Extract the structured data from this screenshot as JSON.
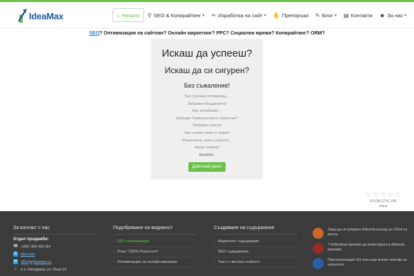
{
  "header": {
    "logo": {
      "text_a": "Idea",
      "text_b": "Max"
    },
    "nav": [
      {
        "label": "Начало",
        "icon": "home-icon",
        "active": true,
        "dropdown": false
      },
      {
        "label": "SEO & Копирайтинг",
        "icon": "search-icon",
        "active": false,
        "dropdown": true
      },
      {
        "label": "Изработка на сайт",
        "icon": "tools-icon",
        "active": false,
        "dropdown": true
      },
      {
        "label": "Препоръки",
        "icon": "thumbs-up-icon",
        "active": false,
        "dropdown": false
      },
      {
        "label": "Блог",
        "icon": "pen-icon",
        "active": false,
        "dropdown": true
      },
      {
        "label": "Контакти",
        "icon": "contacts-icon",
        "active": false,
        "dropdown": false
      },
      {
        "label": "За нас",
        "icon": "user-icon",
        "active": false,
        "dropdown": true
      }
    ]
  },
  "tagline": {
    "link": "SEO",
    "rest": "? Оптимизация на сайтове? Онлайн маркетинг? PPC? Социални мрежи? Копирайтинг? ORM?"
  },
  "hero": {
    "h1": "Искаш да успееш?",
    "h2": "Искаш да си сигурен?",
    "h3": "Без съжаление!",
    "lines": [
      "Без глупава оптимизац...",
      "Забрави обещанията!",
      "Без колебание...",
      "Забрави \"комплексните стратегии\"!",
      "Забрави стреса!",
      "Ние знаем какво е нужно!",
      "Решенията, които работят...",
      "Нищо повече!"
    ],
    "brand": "IdeaMax.",
    "cta": "Действай днес!"
  },
  "rating": {
    "stars_filled": 0,
    "stars_total": 5,
    "text_line1": "4.8 (96.27%) 158",
    "text_line2": "гласа"
  },
  "footer": {
    "contact": {
      "title": "За контакт с нас",
      "sales_label": "Отдел продажби:",
      "phone": "+359 / 896 454 354",
      "skype": "idea-max",
      "email": "office[at]ideamax.eu",
      "address": "ж.к. Хиподрума, ул. Юнак 24"
    },
    "visibility": {
      "title": "Подобряване на видимост",
      "items": [
        "SEO оптимизация",
        "План \"100% Резултати\"",
        "Оптимизация на онлайн магазини"
      ]
    },
    "content": {
      "title": "Създаване на съдържание",
      "items": [
        "Маркетинг съдържание",
        "SEO съдържание",
        "Текст с висока стойност"
      ]
    },
    "posts": [
      {
        "text": "Защо да не купувате Adwords възход за 100лв на месец",
        "color": "#c8682a"
      },
      {
        "text": "7 библейски причини да инвестирате в Adwords реклама",
        "color": "#9a2b2b"
      },
      {
        "text": "Персонализация 101 или къде всичко започва за клиентите",
        "color": "#2b5fa6"
      }
    ]
  },
  "colors": {
    "accent": "#6cc04a",
    "brand_blue": "#1e5a9a",
    "footer_bg": "#3b3b3b"
  }
}
